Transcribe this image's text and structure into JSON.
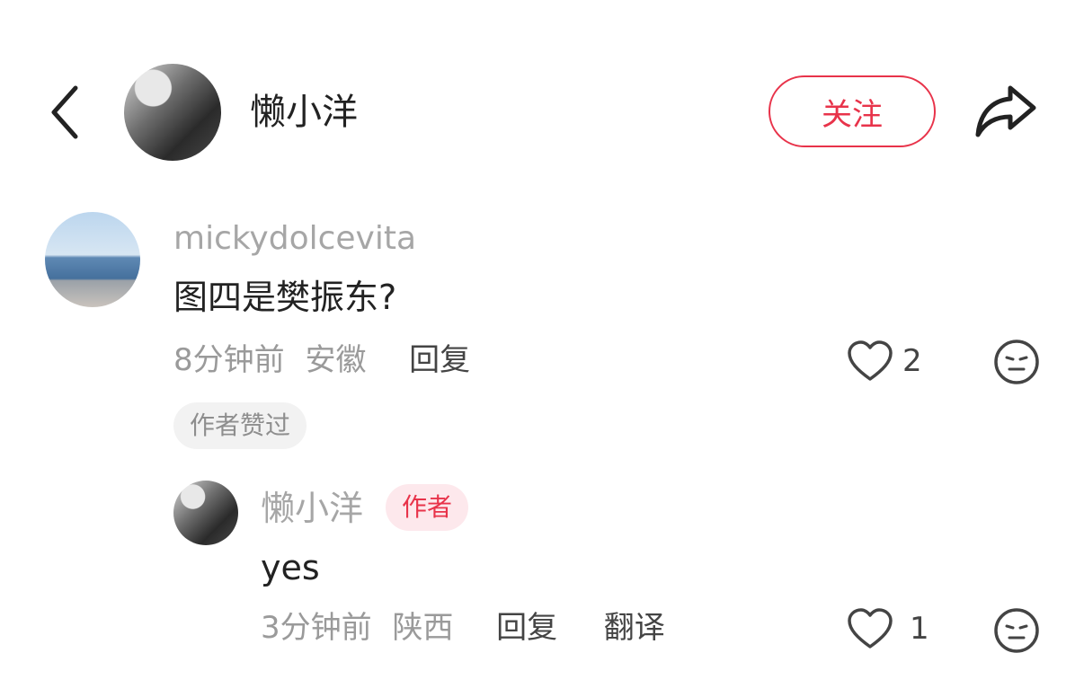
{
  "header": {
    "author_name": "懒小洋",
    "follow_label": "关注"
  },
  "comment": {
    "username": "mickydolcevita",
    "text": "图四是樊振东?",
    "time": "8分钟前",
    "location": "安徽",
    "reply_label": "回复",
    "likes": "2",
    "liked_by_author_badge": "作者赞过"
  },
  "reply": {
    "username": "懒小洋",
    "author_badge": "作者",
    "text": "yes",
    "time": "3分钟前",
    "location": "陕西",
    "reply_label": "回复",
    "translate_label": "翻译",
    "likes": "1"
  },
  "icons": {
    "back": "back-chevron-icon",
    "share": "share-arrow-icon",
    "like": "heart-icon",
    "reaction": "emoji-icon"
  },
  "colors": {
    "accent": "#e8334a",
    "muted_text": "#9a9a9a",
    "badge_bg": "#f2f2f2",
    "author_badge_bg": "#fde8ec"
  }
}
